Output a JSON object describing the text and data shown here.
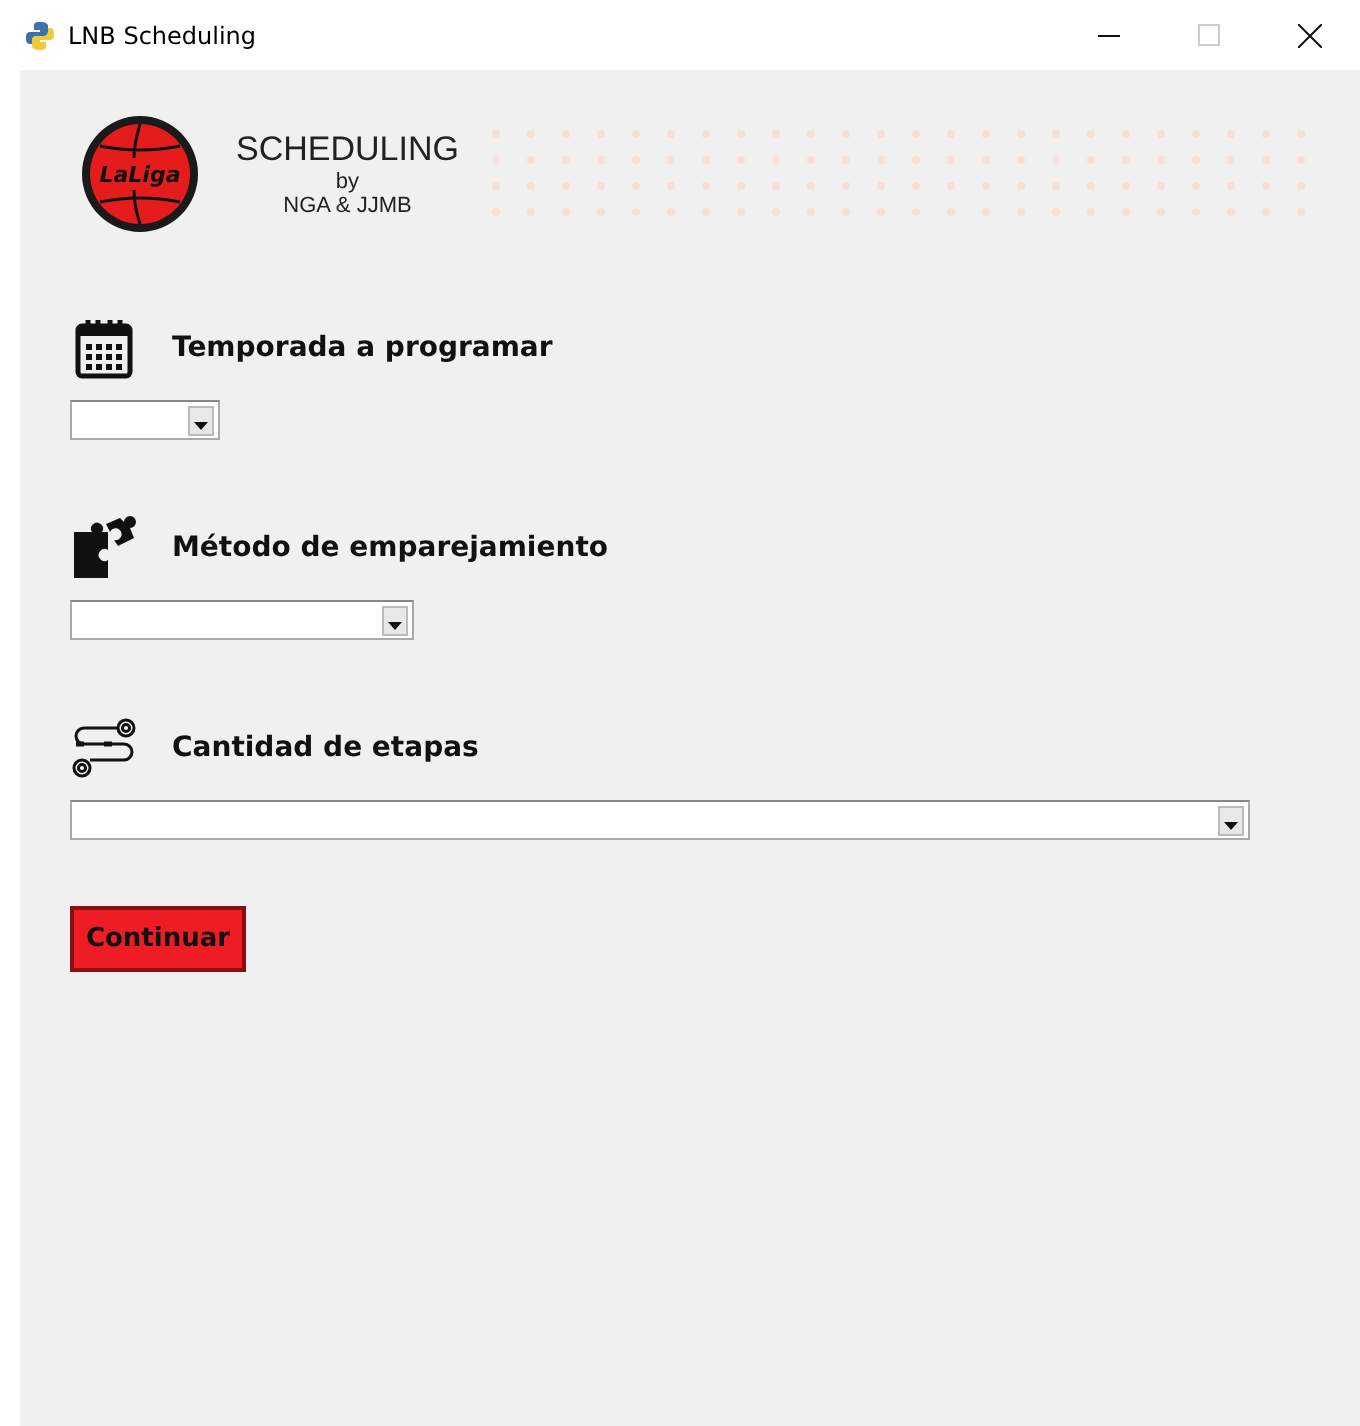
{
  "window": {
    "title": "LNB Scheduling"
  },
  "header": {
    "logo_text": "LaLiga",
    "title": "SCHEDULING",
    "by": "by",
    "authors": "NGA & JJMB"
  },
  "fields": [
    {
      "kind": "calendar",
      "label": "Temporada a programar"
    },
    {
      "kind": "puzzle",
      "label": "Método de emparejamiento"
    },
    {
      "kind": "stages",
      "label": "Cantidad de etapas"
    }
  ],
  "button": {
    "label": "Continuar"
  }
}
